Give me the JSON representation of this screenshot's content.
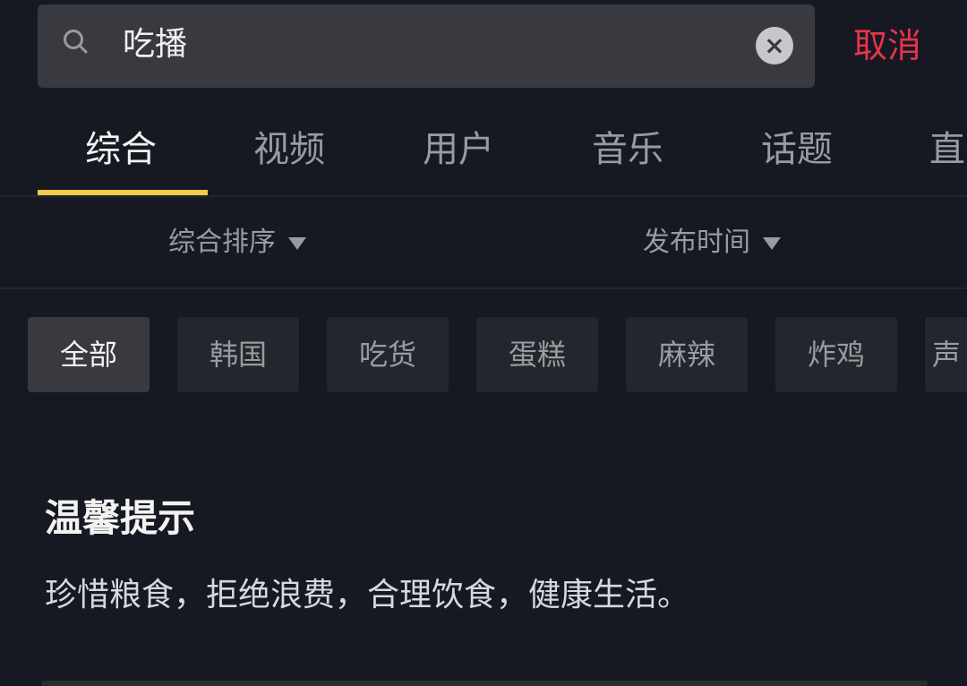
{
  "search": {
    "query": "吃播",
    "cancel_label": "取消",
    "search_icon": "magnifier",
    "clear_icon": "x-circle"
  },
  "tabs": [
    {
      "label": "综合",
      "active": true
    },
    {
      "label": "视频"
    },
    {
      "label": "用户"
    },
    {
      "label": "音乐"
    },
    {
      "label": "话题"
    },
    {
      "label": "直"
    }
  ],
  "filters": {
    "sort_label": "综合排序",
    "time_label": "发布时间"
  },
  "chips": [
    {
      "label": "全部",
      "active": true
    },
    {
      "label": "韩国"
    },
    {
      "label": "吃货"
    },
    {
      "label": "蛋糕"
    },
    {
      "label": "麻辣"
    },
    {
      "label": "炸鸡"
    },
    {
      "label": "声"
    }
  ],
  "notice": {
    "title": "温馨提示",
    "body": "珍惜粮食，拒绝浪费，合理饮食，健康生活。"
  },
  "colors": {
    "accent_tab": "#f2c94c",
    "cancel": "#e8344e",
    "background": "#161922"
  }
}
